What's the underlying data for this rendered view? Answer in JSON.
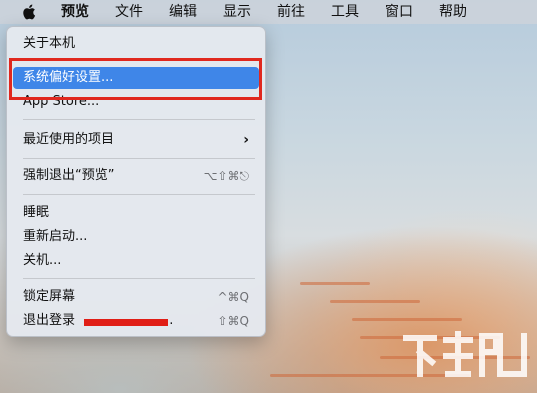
{
  "menubar": {
    "apple_icon": "apple-logo-icon",
    "items": [
      "预览",
      "文件",
      "编辑",
      "显示",
      "前往",
      "工具",
      "窗口",
      "帮助"
    ]
  },
  "apple_menu": {
    "about": "关于本机",
    "system_preferences": "系统偏好设置...",
    "app_store": "App Store...",
    "recent_items": "最近使用的项目",
    "force_quit": "强制退出“预览”",
    "force_quit_shortcut": "⌥⇧⌘⎋",
    "sleep": "睡眠",
    "restart": "重新启动...",
    "shut_down": "关机...",
    "lock_screen": "锁定屏幕",
    "lock_screen_shortcut": "^⌘Q",
    "log_out": "退出登录",
    "log_out_suffix": "...",
    "log_out_shortcut": "⇧⌘Q"
  },
  "watermark": {
    "icon": "download-site-watermark-icon"
  },
  "colors": {
    "highlight": "#3f86e8",
    "annotation_red": "#e0281e"
  }
}
